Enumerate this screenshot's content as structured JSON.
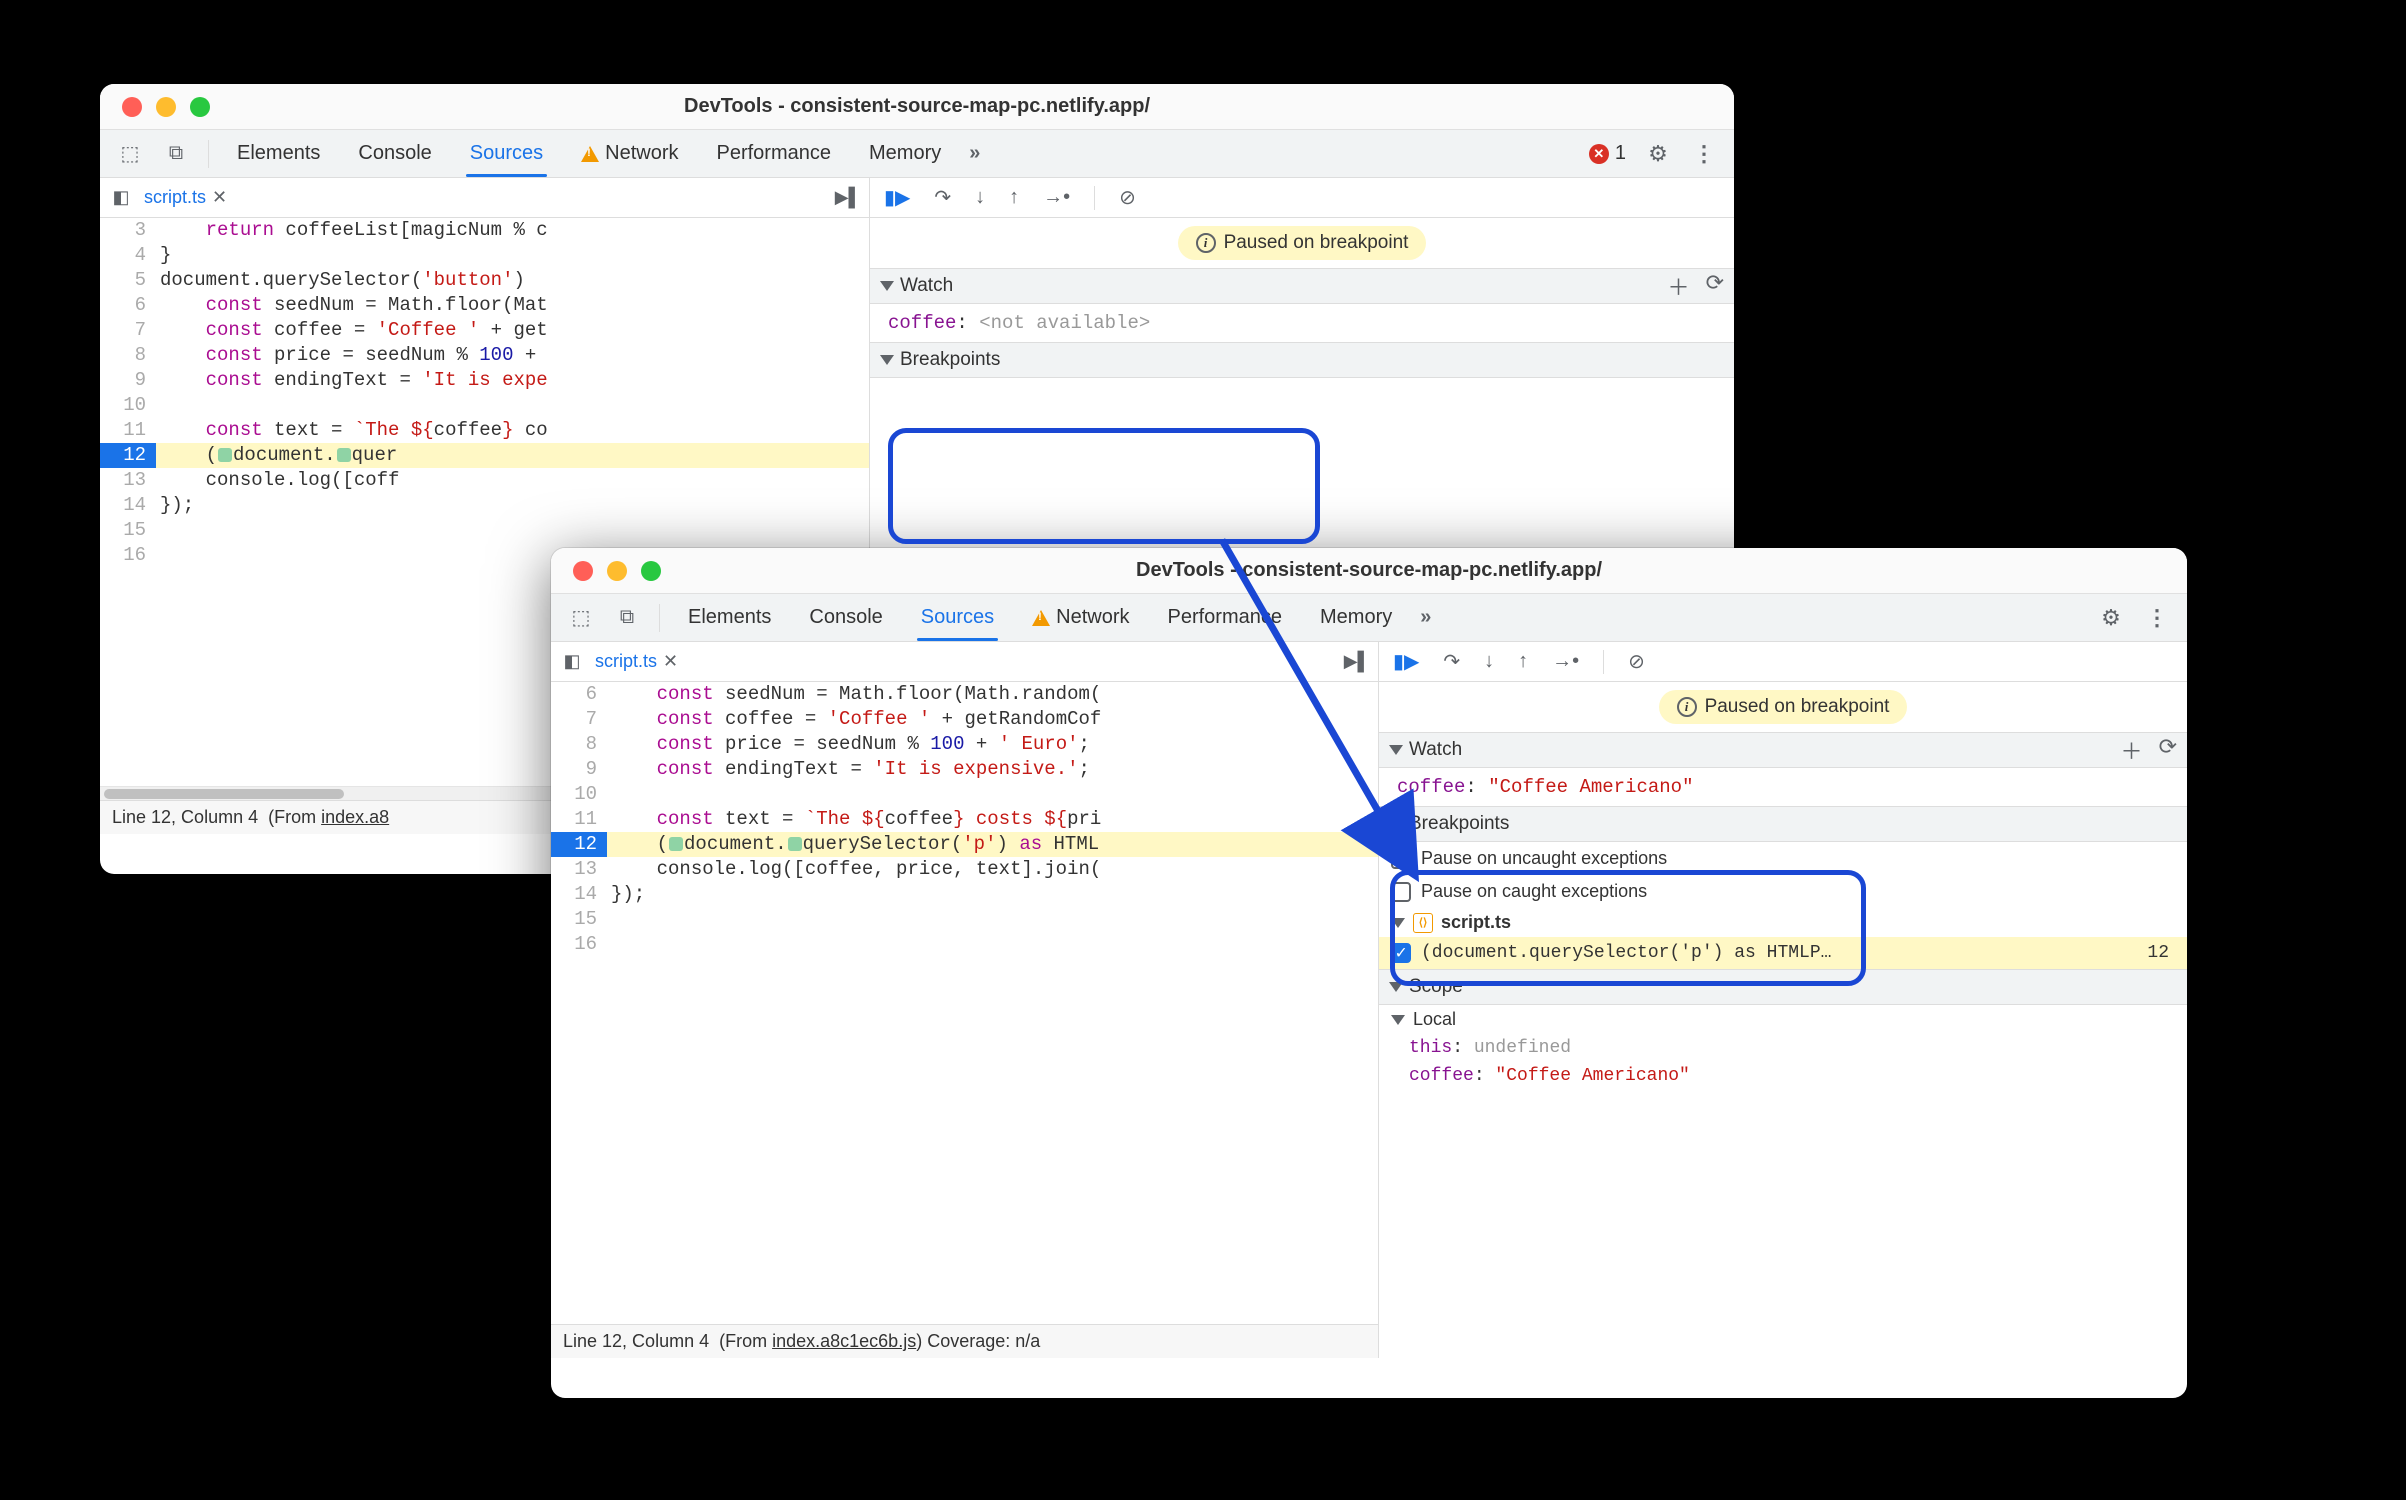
{
  "title": "DevTools - consistent-source-map-pc.netlify.app/",
  "tabs": {
    "elements": "Elements",
    "console": "Console",
    "sources": "Sources",
    "network": "Network",
    "performance": "Performance",
    "memory": "Memory"
  },
  "error_count": "1",
  "file_tab": "script.ts",
  "paused_text": "Paused on breakpoint",
  "watch_label": "Watch",
  "breakpoints_label": "Breakpoints",
  "scope_label": "Scope",
  "local_label": "Local",
  "window1": {
    "code": [
      {
        "n": "3",
        "html": "    <span class='kw'>return</span> coffeeList[magicNum % c"
      },
      {
        "n": "4",
        "html": "}"
      },
      {
        "n": "5",
        "html": "document.querySelector(<span class='str'>'button'</span>)"
      },
      {
        "n": "6",
        "html": "    <span class='kw'>const</span> seedNum = Math.floor(Mat"
      },
      {
        "n": "7",
        "html": "    <span class='kw'>const</span> coffee = <span class='str'>'Coffee '</span> + get"
      },
      {
        "n": "8",
        "html": "    <span class='kw'>const</span> price = seedNum % <span class='num'>100</span> +"
      },
      {
        "n": "9",
        "html": "    <span class='kw'>const</span> endingText = <span class='str'>'It is expe"
      },
      {
        "n": "10",
        "html": ""
      },
      {
        "n": "11",
        "html": "    <span class='kw'>const</span> text = <span class='str'>`The ${</span>coffee<span class='str'>}</span> co"
      },
      {
        "n": "12",
        "html": "    (<span class='dbg-step-marker'></span>document.<span class='dbg-step-marker'></span>quer",
        "hl": true
      },
      {
        "n": "13",
        "html": "    console.log([coff"
      },
      {
        "n": "14",
        "html": "});"
      },
      {
        "n": "15",
        "html": ""
      },
      {
        "n": "16",
        "html": ""
      }
    ],
    "watch_name": "coffee",
    "watch_value": "<not available>",
    "status_line": "Line 12, Column 4",
    "status_from": "(From ",
    "status_link": "index.a8"
  },
  "window2": {
    "code": [
      {
        "n": "6",
        "html": "    <span class='kw'>const</span> seedNum = Math.floor(Math.random("
      },
      {
        "n": "7",
        "html": "    <span class='kw'>const</span> coffee = <span class='str'>'Coffee '</span> + getRandomCof"
      },
      {
        "n": "8",
        "html": "    <span class='kw'>const</span> price = seedNum % <span class='num'>100</span> + <span class='str'>' Euro'</span>;"
      },
      {
        "n": "9",
        "html": "    <span class='kw'>const</span> endingText = <span class='str'>'It is expensive.'</span>;"
      },
      {
        "n": "10",
        "html": ""
      },
      {
        "n": "11",
        "html": "    <span class='kw'>const</span> text = <span class='str'>`The ${</span>coffee<span class='str'>} costs ${</span>pri"
      },
      {
        "n": "12",
        "html": "    (<span class='dbg-step-marker'></span>document.<span class='dbg-step-marker'></span>querySelector(<span class='str'>'p'</span>) <span class='kw'>as</span> HTML",
        "hl": true
      },
      {
        "n": "13",
        "html": "    console.log([coffee, price, text].join("
      },
      {
        "n": "14",
        "html": "});"
      },
      {
        "n": "15",
        "html": ""
      },
      {
        "n": "16",
        "html": ""
      }
    ],
    "watch_name": "coffee",
    "watch_value": "\"Coffee Americano\"",
    "bp_uncaught": "Pause on uncaught exceptions",
    "bp_caught": "Pause on caught exceptions",
    "bp_file": "script.ts",
    "bp_text": "(document.querySelector('p') as HTMLP…",
    "bp_line": "12",
    "scope_this_name": "this",
    "scope_this_val": "undefined",
    "scope_coffee_name": "coffee",
    "scope_coffee_val": "\"Coffee Americano\"",
    "status_line": "Line 12, Column 4",
    "status_from": "(From ",
    "status_link": "index.a8c1ec6b.js",
    "status_coverage": ") Coverage: n/a"
  }
}
